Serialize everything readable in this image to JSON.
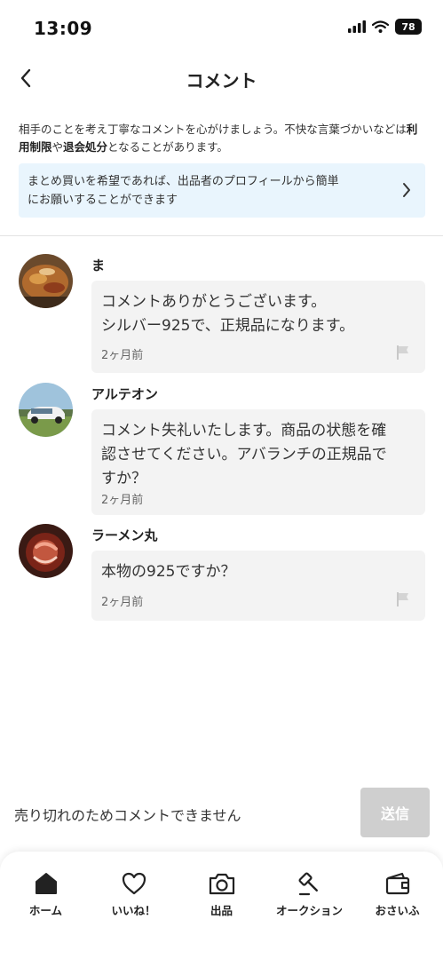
{
  "status_bar": {
    "time": "13:09",
    "battery": "78"
  },
  "header": {
    "title": "コメント"
  },
  "notice": {
    "before": "相手のことを考え丁寧なコメントを心がけましょう。不快な言葉づかいなどは",
    "bold1": "利用制限",
    "mid": "や",
    "bold2": "退会処分",
    "after": "となることがあります。"
  },
  "bulk_banner": {
    "line1": "まとめ買いを希望であれば、出品者のプロフィールから簡単",
    "line2": "にお願いすることができます"
  },
  "comments": [
    {
      "user": "ま",
      "lines": [
        "コメントありがとうございます。",
        "シルバー925で、正規品になります。"
      ],
      "time": "2ヶ月前"
    },
    {
      "user": "アルテオン",
      "lines": [
        "コメント失礼いたします。商品の状態を確",
        "認させてください。アバランチの正規品で",
        "すか？"
      ],
      "time": "2ヶ月前"
    },
    {
      "user": "ラーメン丸",
      "lines": [
        "本物の925ですか？"
      ],
      "time": "2ヶ月前"
    }
  ],
  "footer": {
    "message": "売り切れのためコメントできません",
    "send_label": "送信"
  },
  "tabs": [
    {
      "label": "ホーム",
      "icon": "home-icon"
    },
    {
      "label": "いいね！",
      "icon": "heart-icon"
    },
    {
      "label": "出品",
      "icon": "camera-icon"
    },
    {
      "label": "オークション",
      "icon": "gavel-icon"
    },
    {
      "label": "おさいふ",
      "icon": "wallet-icon"
    }
  ]
}
